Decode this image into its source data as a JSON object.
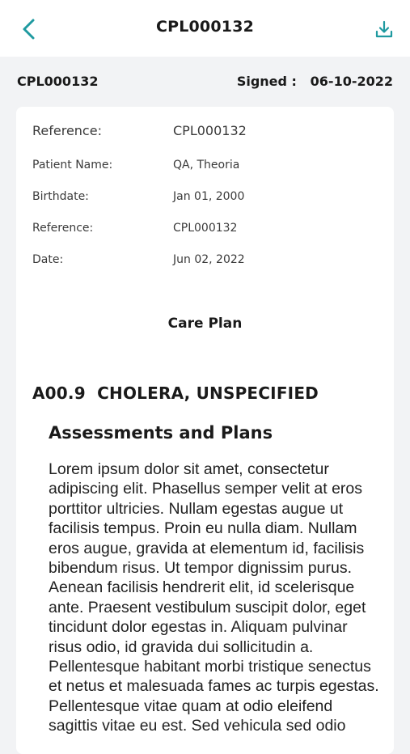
{
  "header": {
    "title": "CPL000132",
    "back_icon": "chevron-left-icon",
    "download_icon": "download-icon",
    "accent_color": "#1f9aa0"
  },
  "info_bar": {
    "reference": "CPL000132",
    "signed_label": "Signed :",
    "signed_date": "06-10-2022"
  },
  "details": {
    "top_reference": {
      "label": "Reference:",
      "value": "CPL000132"
    },
    "patient_name": {
      "label": "Patient Name:",
      "value": "QA, Theoria"
    },
    "birthdate": {
      "label": "Birthdate:",
      "value": "Jan 01, 2000"
    },
    "reference": {
      "label": "Reference:",
      "value": "CPL000132"
    },
    "date": {
      "label": "Date:",
      "value": "Jun 02, 2022"
    }
  },
  "document": {
    "heading": "Care Plan",
    "diagnosis_code": "A00.9",
    "diagnosis_name": "CHOLERA, UNSPECIFIED",
    "section_title": "Assessments and Plans",
    "body": "Lorem ipsum dolor sit amet, consectetur adipiscing elit. Phasellus semper velit at eros porttitor ultricies. Nullam egestas augue ut facilisis tempus. Proin eu nulla diam. Nullam eros augue, gravida at elementum id, facilisis bibendum risus. Ut tempor dignissim purus. Aenean facilisis hendrerit elit, id scelerisque ante. Praesent vestibulum suscipit dolor, eget tincidunt dolor egestas in. Aliquam pulvinar risus odio, id gravida dui sollicitudin a. Pellentesque habitant morbi tristique senectus et netus et malesuada fames ac turpis egestas. Pellentesque vitae quam at odio eleifend sagittis vitae eu est. Sed vehicula sed odio"
  }
}
